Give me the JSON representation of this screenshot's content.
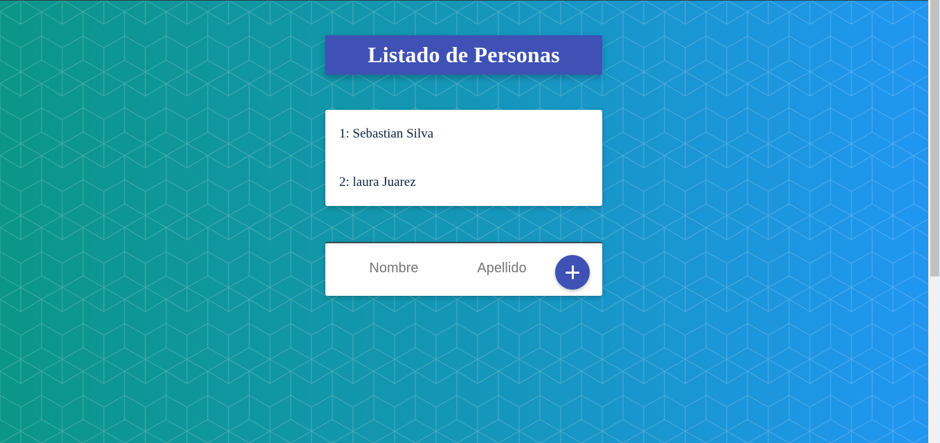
{
  "header": {
    "title": "Listado de Personas"
  },
  "people": [
    {
      "label": "1: Sebastian Silva"
    },
    {
      "label": "2: laura Juarez"
    }
  ],
  "form": {
    "nombre_placeholder": "Nombre",
    "apellido_placeholder": "Apellido",
    "nombre_value": "",
    "apellido_value": "",
    "add_button_icon": "plus-icon"
  },
  "colors": {
    "gradient_start": "#0b9688",
    "gradient_end": "#2196f3",
    "accent": "#3f51b5",
    "text_dark": "#0d2142"
  }
}
